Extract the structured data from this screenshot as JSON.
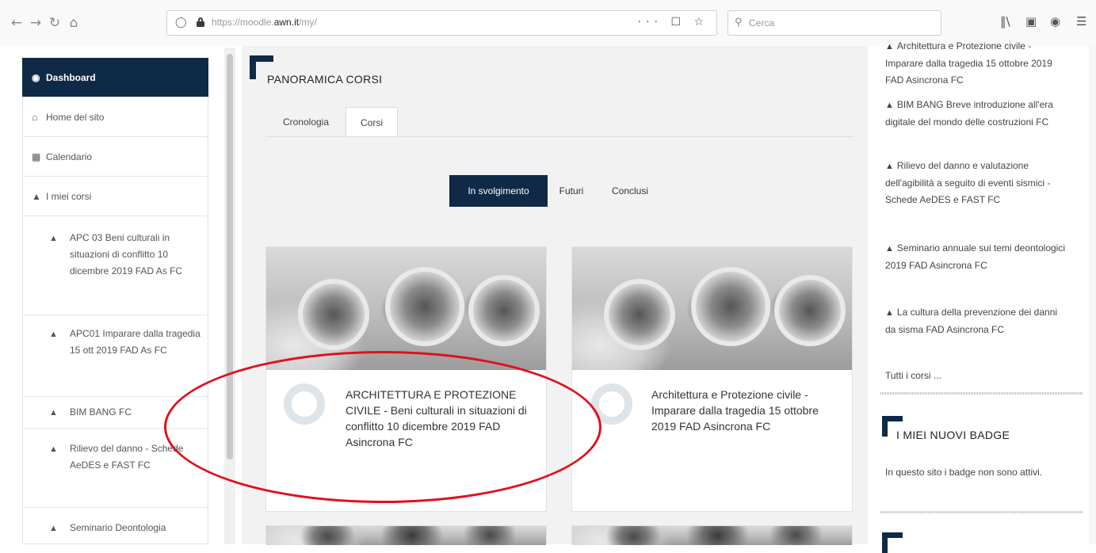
{
  "browser": {
    "url_prefix": "https://moodle.",
    "url_domain": "awn.it",
    "url_suffix": "/my/",
    "url_actions": "··· ☐ ☆",
    "search_placeholder": "Cerca"
  },
  "sidebar": {
    "items": [
      {
        "label": "Dashboard",
        "icon": "dashboard-icon"
      },
      {
        "label": "Home del sito",
        "icon": "home-icon"
      },
      {
        "label": "Calendario",
        "icon": "calendar-icon"
      },
      {
        "label": "I miei corsi",
        "icon": "graduation-cap-icon"
      }
    ],
    "courses": [
      "APC 03 Beni culturali in situazioni di conflitto 10 dicembre 2019 FAD As FC",
      "APC01 Imparare dalla tragedia 15 ott 2019 FAD As FC",
      "BIM BANG FC",
      "Rilievo del danno - Schede AeDES e FAST FC",
      "Seminario Deontologia"
    ]
  },
  "main": {
    "block_title": "PANORAMICA CORSI",
    "tabs": [
      "Cronologia",
      "Corsi"
    ],
    "filters": [
      "In svolgimento",
      "Futuri",
      "Conclusi"
    ],
    "cards": [
      {
        "progress": "0%",
        "title": "ARCHITETTURA E PROTEZIONE CIVILE - Beni culturali in situazioni di conflitto 10 dicembre 2019 FAD Asincrona FC"
      },
      {
        "progress": "0%",
        "title": "Architettura e Protezione civile - Imparare dalla tragedia 15 ottobre 2019 FAD Asincrona FC"
      }
    ]
  },
  "right": {
    "courses": [
      "Architettura e Protezione civile - Imparare dalla tragedia 15 ottobre 2019 FAD Asincrona FC",
      "BIM BANG Breve introduzione all'era digitale del mondo delle costruzioni FC",
      "Rilievo del danno e valutazione dell'agibilità a seguito di eventi sismici - Schede AeDES e FAST FC",
      "Seminario annuale sui temi deontologici 2019 FAD Asincrona FC",
      "La cultura della prevenzione dei danni da sisma FAD Asincrona FC"
    ],
    "all_courses": "Tutti i corsi ...",
    "badges_title": "I MIEI NUOVI BADGE",
    "badges_text": "In questo sito i badge non sono attivi."
  },
  "colors": {
    "accent": "#0f2a47",
    "highlight": "#e0101a"
  }
}
